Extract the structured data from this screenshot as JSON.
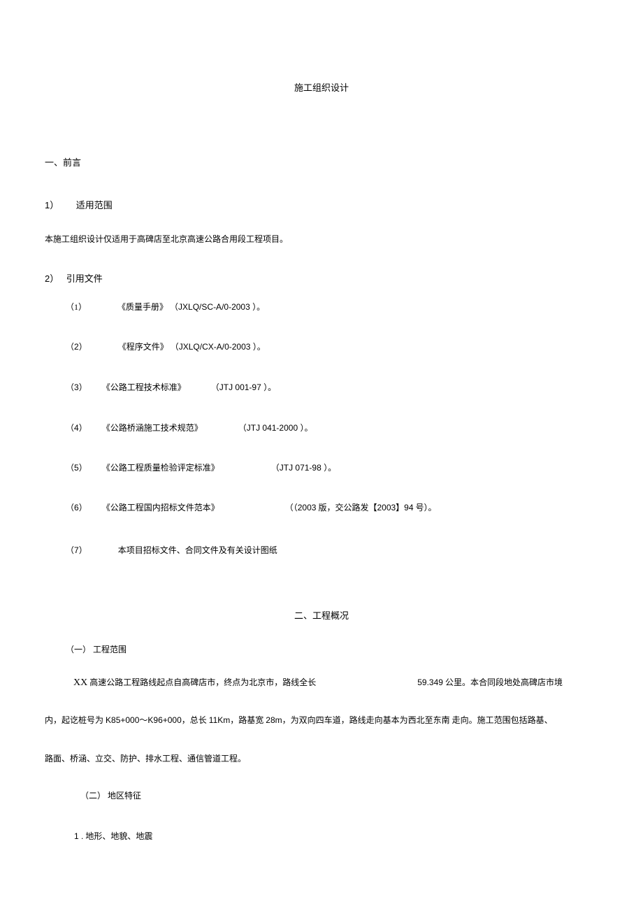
{
  "title": "施工组织设计",
  "section1": {
    "heading": "一、前言",
    "item1": {
      "num": "1）",
      "label": "适用范围"
    },
    "para1": "本施工组织设计仅适用于高碑店至北京高速公路合用段工程项目。",
    "item2": {
      "num": "2）",
      "label": "引用文件"
    },
    "refs": [
      {
        "num": "（1）",
        "text": "《质量手册》",
        "code": "（JXLQ/SC-A/0-2003 ）。"
      },
      {
        "num": "（2）",
        "text": "《程序文件》",
        "code": "（JXLQ/CX-A/0-2003 ）。"
      },
      {
        "num": "（3）",
        "text": "《公路工程技术标准》",
        "code": "（JTJ 001-97 ）。"
      },
      {
        "num": "（4）",
        "text": "《公路桥涵施工技术规范》",
        "code": "（JTJ 041-2000 ）。"
      },
      {
        "num": "（5）",
        "text": "《公路工程质量检验评定标准》",
        "code": "（JTJ 071-98 ）。"
      },
      {
        "num": "（6）",
        "text": "《公路工程国内招标文件范本》",
        "code_pre": "（2003",
        "code_mid": " 版，交公路发【",
        "code_num": "2003】94",
        "code_end": " 号）。"
      },
      {
        "num": "（7）",
        "text": "本项目招标文件、合同文件及有关设计图纸"
      }
    ]
  },
  "section2": {
    "heading": "二、工程概况",
    "sub1": "（一） 工程范围",
    "para1_pre": "XX",
    "para1_mid": " 高速公路工程路线起点自高碑店市，终点为北京市，路线全长",
    "para1_num": "59.349",
    "para1_end": " 公里。本合同段地处高碑店市境",
    "para2_a": "内，起讫桩号为 ",
    "para2_code1": "K85+000～K96+000，",
    "para2_b": "总长 ",
    "para2_code2": "11Km，",
    "para2_c": "路基宽 ",
    "para2_code3": "28m，",
    "para2_d": "为双向四车道，路线走向基本为西北至东南  走向。施工范围包括路基、",
    "para3": "路面、桥涵、立交、防护、排水工程、通信管道工程。",
    "sub2": "（二） 地区特征",
    "sub2_1_num": "1 .",
    "sub2_1_text": " 地形、地貌、地震"
  }
}
